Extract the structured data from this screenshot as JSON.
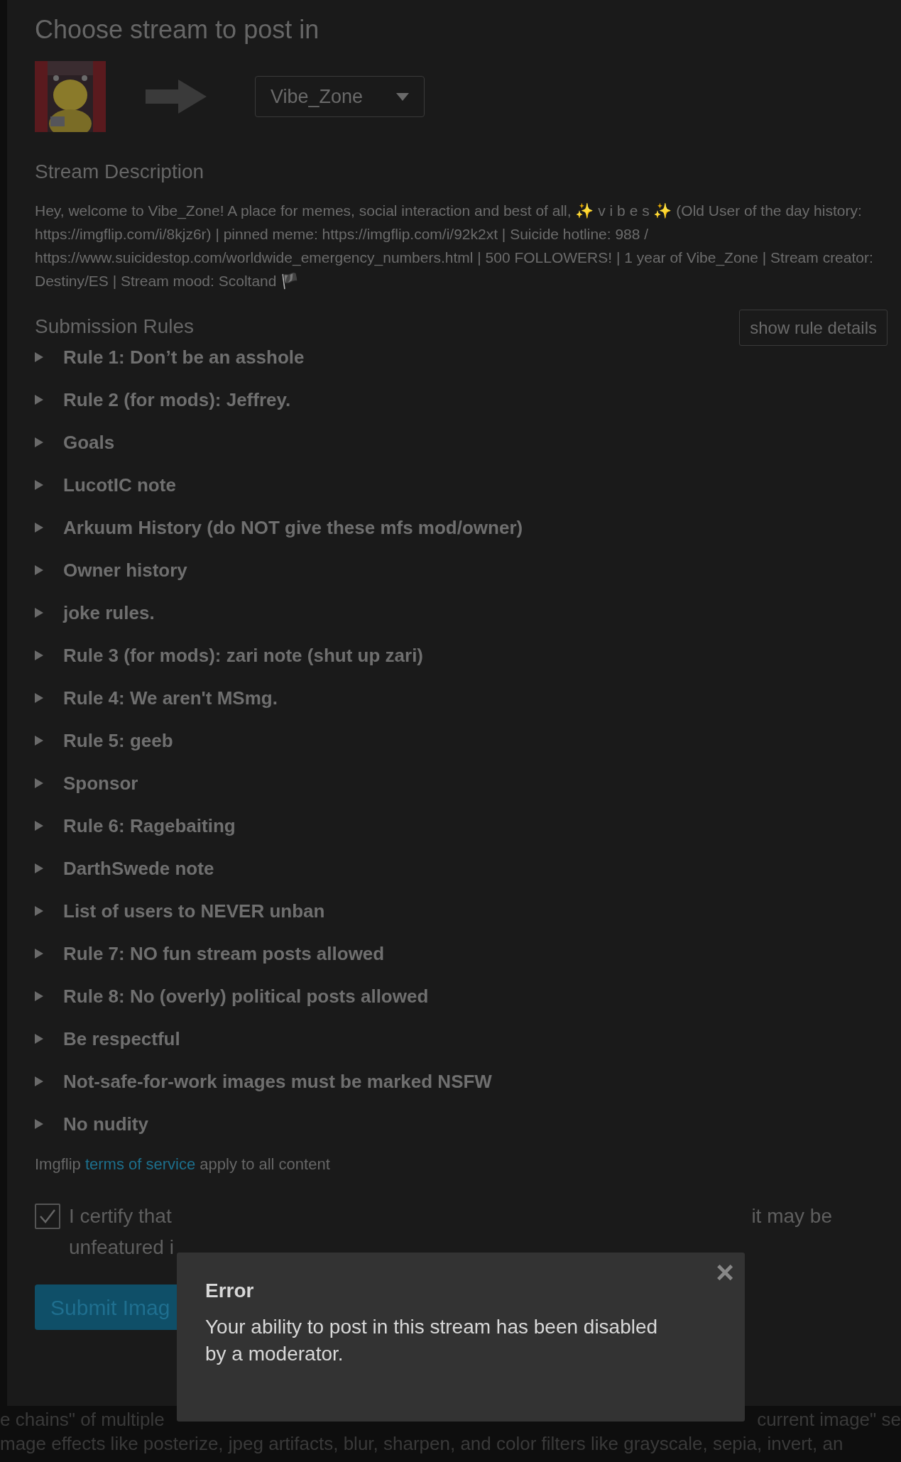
{
  "title": "Choose stream to post in",
  "stream_select": {
    "value": "Vibe_Zone"
  },
  "description": {
    "heading": "Stream Description",
    "text": "Hey, welcome to Vibe_Zone! A place for memes, social interaction and best of all, ✨ v i b e s ✨ (Old User of the day history: https://imgflip.com/i/8kjz6r) | pinned meme: https://imgflip.com/i/92k2xt | Suicide hotline: 988 / https://www.suicidestop.com/worldwide_emergency_numbers.html | 500 FOLLOWERS! | 1 year of Vibe_Zone | Stream creator: Destiny/ES | Stream mood: Scoltand 🏴"
  },
  "rules": {
    "heading": "Submission Rules",
    "toggle_button": "show rule details",
    "items": [
      {
        "label": "Rule 1: Don’t be an asshole",
        "expanded": false
      },
      {
        "label": "Rule 2 (for mods): Jeffrey.",
        "expanded": false
      },
      {
        "label": "Goals",
        "expanded": false
      },
      {
        "label": "LucotIC note",
        "expanded": false
      },
      {
        "label": "Arkuum History (do NOT give these mfs mod/owner)",
        "expanded": false
      },
      {
        "label": "Owner history",
        "expanded": false
      },
      {
        "label": "joke rules.",
        "expanded": false
      },
      {
        "label": "Rule 3 (for mods): zari note (shut up zari)",
        "expanded": false
      },
      {
        "label": "Rule 4: We aren't MSmg.",
        "expanded": false
      },
      {
        "label": "Rule 5: geeb",
        "expanded": false
      },
      {
        "label": "Sponsor",
        "expanded": false
      },
      {
        "label": "Rule 6: Ragebaiting",
        "expanded": false
      },
      {
        "label": "DarthSwede note",
        "expanded": false
      },
      {
        "label": "List of users to NEVER unban",
        "expanded": false
      },
      {
        "label": "Rule 7: NO fun stream posts allowed",
        "expanded": false
      },
      {
        "label": "Rule 8: No (overly) political posts allowed",
        "expanded": false
      },
      {
        "label": "Be respectful",
        "expanded": false
      },
      {
        "label": "Not-safe-for-work images must be marked NSFW",
        "expanded": false
      },
      {
        "label": "No nudity",
        "expanded": false
      }
    ]
  },
  "terms": {
    "before": "Imgflip",
    "link": "terms of service",
    "after": "apply to all content"
  },
  "certify": {
    "checked": true,
    "line_1_start": "I certify that",
    "line_1_end": "it may be",
    "line_2_start": "unfeatured i"
  },
  "submit_button": "Submit Imag",
  "background_text": {
    "line_1_start": "e chains\" of multiple",
    "line_1_end": "current image\" se",
    "line_2": "mage effects like posterize, jpeg artifacts, blur, sharpen, and color filters like grayscale, sepia, invert, an"
  },
  "dialog": {
    "close": "×",
    "title": "Error",
    "message": "Your ability to post in this stream has been disabled by a moderator."
  }
}
